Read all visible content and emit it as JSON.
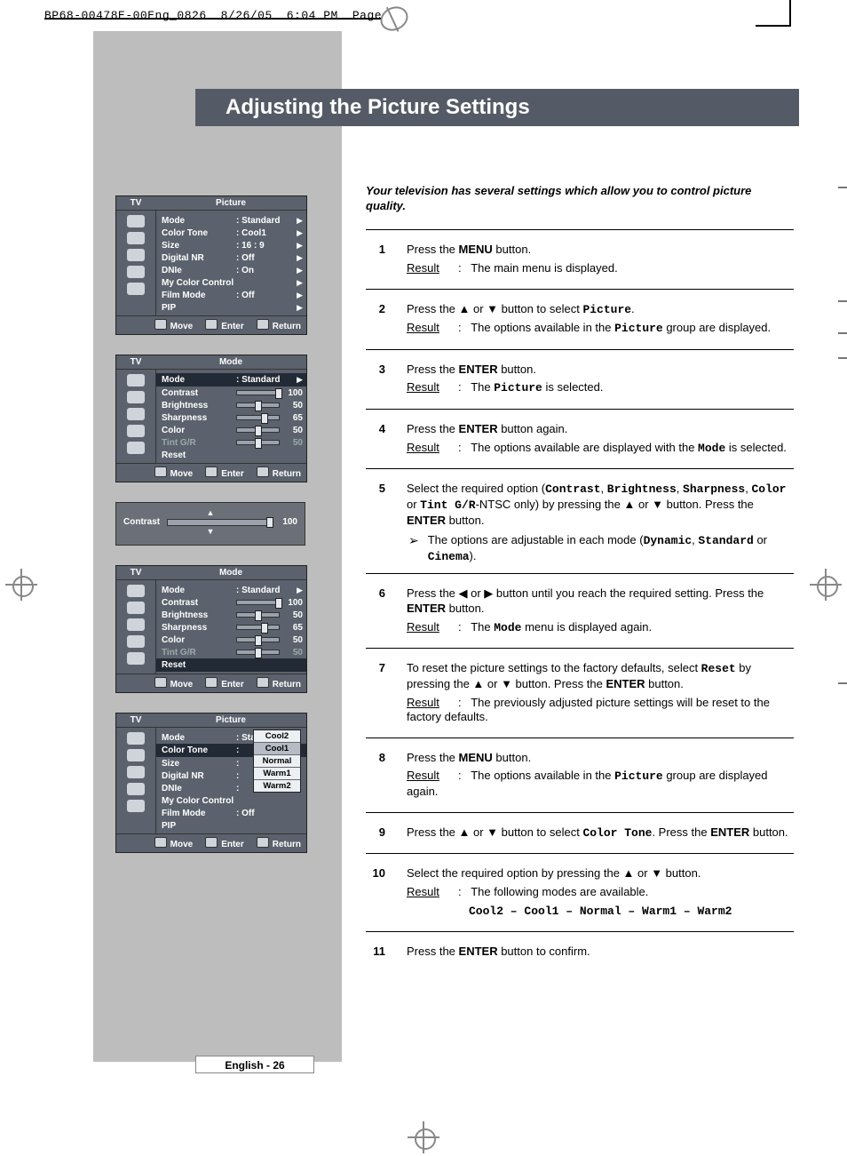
{
  "slug": {
    "file": "BP68-00478E-00Eng_0826",
    "date": "8/26/05",
    "time": "6:04 PM",
    "page": "Page 26"
  },
  "title": "Adjusting the Picture Settings",
  "intro": "Your television has several settings which allow you to control picture quality.",
  "page_number": "English - 26",
  "osd_foot": {
    "move": "Move",
    "enter": "Enter",
    "return": "Return"
  },
  "osd1": {
    "hl": "TV",
    "hr": "Picture",
    "rows": [
      {
        "k": "Mode",
        "v": ": Standard",
        "arrow": true
      },
      {
        "k": "Color Tone",
        "v": ": Cool1",
        "arrow": true
      },
      {
        "k": "Size",
        "v": ": 16 : 9",
        "arrow": true
      },
      {
        "k": "Digital NR",
        "v": ": Off",
        "arrow": true
      },
      {
        "k": "DNIe",
        "v": ": On",
        "arrow": true
      },
      {
        "k": "My Color Control",
        "v": "",
        "arrow": true
      },
      {
        "k": "Film Mode",
        "v": ": Off",
        "arrow": true
      },
      {
        "k": "PIP",
        "v": "",
        "arrow": true
      }
    ]
  },
  "osd2": {
    "hl": "TV",
    "hr": "Mode",
    "rows": [
      {
        "k": "Mode",
        "v": ": Standard",
        "arrow": true,
        "sel": true
      },
      {
        "k": "Contrast",
        "slider": 100,
        "val": "100"
      },
      {
        "k": "Brightness",
        "slider": 50,
        "val": "50"
      },
      {
        "k": "Sharpness",
        "slider": 65,
        "val": "65"
      },
      {
        "k": "Color",
        "slider": 50,
        "val": "50"
      },
      {
        "k": "Tint G/R",
        "slider": 50,
        "val": "50",
        "dim": true
      },
      {
        "k": "Reset",
        "v": "",
        "arrow": false
      }
    ]
  },
  "contrast_bar": {
    "label": "Contrast",
    "value": "100",
    "pos": 100
  },
  "osd3": {
    "hl": "TV",
    "hr": "Mode",
    "rows": [
      {
        "k": "Mode",
        "v": ": Standard",
        "arrow": true
      },
      {
        "k": "Contrast",
        "slider": 100,
        "val": "100"
      },
      {
        "k": "Brightness",
        "slider": 50,
        "val": "50"
      },
      {
        "k": "Sharpness",
        "slider": 65,
        "val": "65"
      },
      {
        "k": "Color",
        "slider": 50,
        "val": "50"
      },
      {
        "k": "Tint G/R",
        "slider": 50,
        "val": "50",
        "dim": true
      },
      {
        "k": "Reset",
        "v": "",
        "arrow": false,
        "sel": true
      }
    ]
  },
  "osd4": {
    "hl": "TV",
    "hr": "Picture",
    "rows": [
      {
        "k": "Mode",
        "v": ": Standard"
      },
      {
        "k": "Color Tone",
        "v": ":",
        "sel": true
      },
      {
        "k": "Size",
        "v": ":"
      },
      {
        "k": "Digital NR",
        "v": ":"
      },
      {
        "k": "DNIe",
        "v": ":"
      },
      {
        "k": "My Color Control",
        "v": ""
      },
      {
        "k": "Film Mode",
        "v": ": Off"
      },
      {
        "k": "PIP",
        "v": ""
      }
    ],
    "dropdown": [
      "Cool2",
      "Cool1",
      "Normal",
      "Warm1",
      "Warm2"
    ],
    "dropdown_selected": 1
  },
  "steps": [
    {
      "n": "1",
      "main": "Press the <strong>MENU</strong> button.",
      "result_label": "Result",
      "result": "The main menu is displayed."
    },
    {
      "n": "2",
      "main": "Press the ▲ or ▼ button to select <span class='cw'>Picture</span>.",
      "result_label": "Result",
      "result": "The options available in the <span class='cw'>Picture</span> group are displayed."
    },
    {
      "n": "3",
      "main": "Press the <strong>ENTER</strong> button.",
      "result_label": "Result",
      "result": "The <span class='cw'>Picture</span> is selected."
    },
    {
      "n": "4",
      "main": "Press the <strong>ENTER</strong> button again.",
      "result_label": "Result",
      "result": "The options available are displayed with the <span class='cw'>Mode</span> is selected."
    },
    {
      "n": "5",
      "main": "Select the required option (<span class='cw'>Contrast</span>, <span class='cw'>Brightness</span>, <span class='cw'>Sharpness</span>, <span class='cw'>Color</span> or <span class='cw'>Tint G/R</span>-NTSC only) by pressing the ▲ or ▼ button. Press the <strong>ENTER</strong> button.",
      "note_sym": "➢",
      "note": "The options are adjustable in each mode (<span class='cw'>Dynamic</span>, <span class='cw'>Standard</span> or <span class='cw'>Cinema</span>)."
    },
    {
      "n": "6",
      "main": "Press the ◀ or ▶ button until you reach the required setting. Press the <strong>ENTER</strong> button.",
      "result_label": "Result",
      "result": "The <span class='cw'>Mode</span> menu is displayed again."
    },
    {
      "n": "7",
      "main": "To reset the picture settings to the factory defaults, select <span class='cw'>Reset</span> by pressing the ▲ or ▼ button. Press the <strong>ENTER</strong> button.",
      "result_label": "Result",
      "result": "The previously adjusted picture settings will be reset to the factory defaults."
    },
    {
      "n": "8",
      "main": "Press the <strong>MENU</strong> button.",
      "result_label": "Result",
      "result": "The options available in the <span class='cw'>Picture</span> group are displayed again."
    },
    {
      "n": "9",
      "main": "Press the ▲ or ▼ button to select <span class='cw'>Color Tone</span>. Press the <strong>ENTER</strong> button."
    },
    {
      "n": "10",
      "main": "Select the required option by pressing the ▲ or ▼ button.",
      "result_label": "Result",
      "result": "The following modes are available.",
      "extra": "<span class='cw'>Cool2 – Cool1 – Normal – Warm1 – Warm2</span>"
    },
    {
      "n": "11",
      "main": "Press the <strong>ENTER</strong> button to confirm."
    }
  ]
}
